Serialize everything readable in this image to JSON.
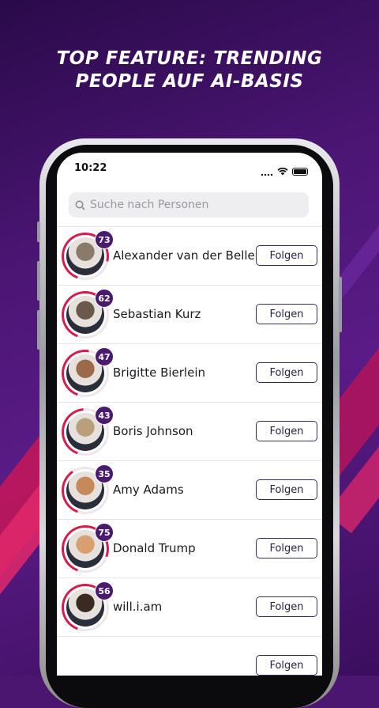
{
  "headline": {
    "line1": "TOP FEATURE: TRENDING",
    "line2": "PEOPLE AUF AI-BASIS"
  },
  "status_bar": {
    "time": "10:22"
  },
  "search": {
    "placeholder": "Suche nach Personen"
  },
  "colors": {
    "accent": "#e0296b",
    "badge": "#4a1a6e",
    "ring": "#d81b4c"
  },
  "people": [
    {
      "name": "Alexander van der Bellen",
      "score": "73",
      "follow_label": "Folgen"
    },
    {
      "name": "Sebastian Kurz",
      "score": "62",
      "follow_label": "Folgen"
    },
    {
      "name": "Brigitte Bierlein",
      "score": "47",
      "follow_label": "Folgen"
    },
    {
      "name": "Boris Johnson",
      "score": "43",
      "follow_label": "Folgen"
    },
    {
      "name": "Amy Adams",
      "score": "35",
      "follow_label": "Folgen"
    },
    {
      "name": "Donald Trump",
      "score": "75",
      "follow_label": "Folgen"
    },
    {
      "name": "will.i.am",
      "score": "56",
      "follow_label": "Folgen"
    },
    {
      "name": "",
      "score": "",
      "follow_label": "Folgen"
    }
  ]
}
